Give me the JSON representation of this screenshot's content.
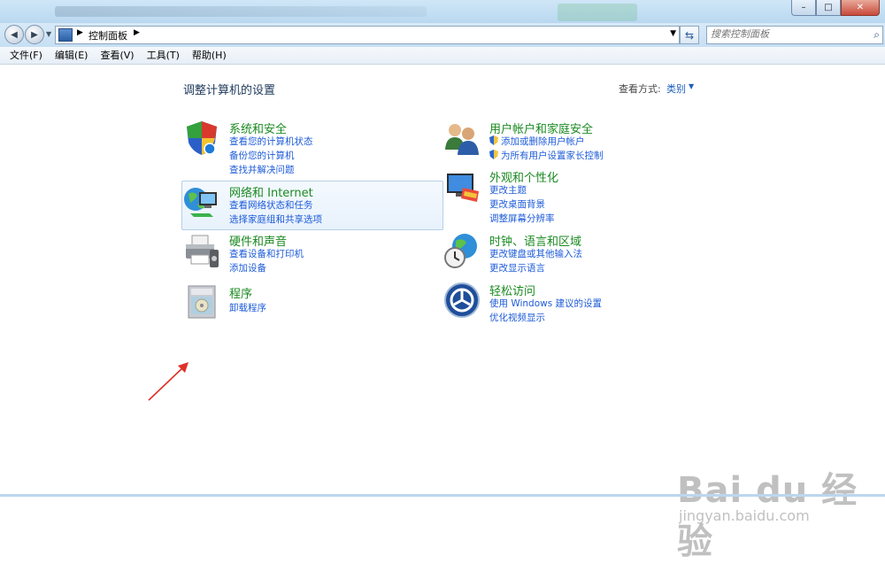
{
  "window": {
    "minimize": "–",
    "maximize": "□",
    "close": "✕"
  },
  "address": {
    "back": "◀",
    "forward": "▶",
    "crumb_sep": "▶",
    "location": "控制面板",
    "dropdown": "▼",
    "refresh": "⇆",
    "search_placeholder": "搜索控制面板",
    "search_icon": "⌕"
  },
  "menu": [
    "文件(F)",
    "编辑(E)",
    "查看(V)",
    "工具(T)",
    "帮助(H)"
  ],
  "page": {
    "title": "调整计算机的设置",
    "view_by_label": "查看方式:",
    "view_by_value": "类别",
    "view_by_arrow": "▼"
  },
  "categories_left": [
    {
      "title": "系统和安全",
      "links": [
        "查看您的计算机状态",
        "备份您的计算机",
        "查找并解决问题"
      ],
      "icon": "shield-icon"
    },
    {
      "title": "网络和 Internet",
      "links": [
        "查看网络状态和任务",
        "选择家庭组和共享选项"
      ],
      "icon": "network-globe-icon"
    },
    {
      "title": "硬件和声音",
      "links": [
        "查看设备和打印机",
        "添加设备"
      ],
      "icon": "printer-icon"
    },
    {
      "title": "程序",
      "links": [
        "卸载程序"
      ],
      "icon": "programs-icon"
    }
  ],
  "categories_right": [
    {
      "title": "用户帐户和家庭安全",
      "links": [
        "添加或删除用户帐户",
        "为所有用户设置家长控制"
      ],
      "icon": "users-icon"
    },
    {
      "title": "外观和个性化",
      "links": [
        "更改主题",
        "更改桌面背景",
        "调整屏幕分辨率"
      ],
      "icon": "monitor-palette-icon"
    },
    {
      "title": "时钟、语言和区域",
      "links": [
        "更改键盘或其他输入法",
        "更改显示语言"
      ],
      "icon": "clock-globe-icon"
    },
    {
      "title": "轻松访问",
      "links": [
        "使用 Windows 建议的设置",
        "优化视频显示"
      ],
      "icon": "ease-of-access-icon"
    }
  ],
  "watermark": {
    "main": "Bai du 经验",
    "sub": "jingyan.baidu.com"
  },
  "colors": {
    "category_title": "#1b8a21",
    "link": "#1d5bd8",
    "annotation_arrow": "#e0302a"
  }
}
